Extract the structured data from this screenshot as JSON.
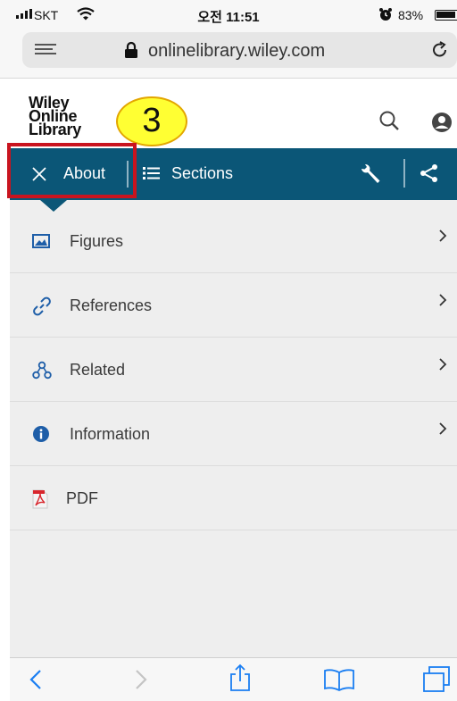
{
  "status_bar": {
    "carrier": "SKT",
    "time": "오전 11:51",
    "battery_percent": "83%"
  },
  "browser": {
    "url": "onlinelibrary.wiley.com"
  },
  "site": {
    "logo_line1": "Wiley",
    "logo_line2": "Online",
    "logo_line3": "Library"
  },
  "tutorial": {
    "step_number": "3",
    "marker_color": "#ffff33",
    "highlight_color": "#c9141f"
  },
  "article_nav": {
    "about_label": "About",
    "sections_label": "Sections",
    "bar_color": "#0b5677"
  },
  "menu": {
    "items": [
      {
        "label": "Figures",
        "icon": "image-icon"
      },
      {
        "label": "References",
        "icon": "link-icon"
      },
      {
        "label": "Related",
        "icon": "network-icon"
      },
      {
        "label": "Information",
        "icon": "info-icon"
      },
      {
        "label": "PDF",
        "icon": "pdf-icon"
      }
    ]
  },
  "toolbar": {
    "icons": [
      "back-icon",
      "forward-icon",
      "share-icon",
      "bookmarks-icon",
      "tabs-icon"
    ]
  }
}
